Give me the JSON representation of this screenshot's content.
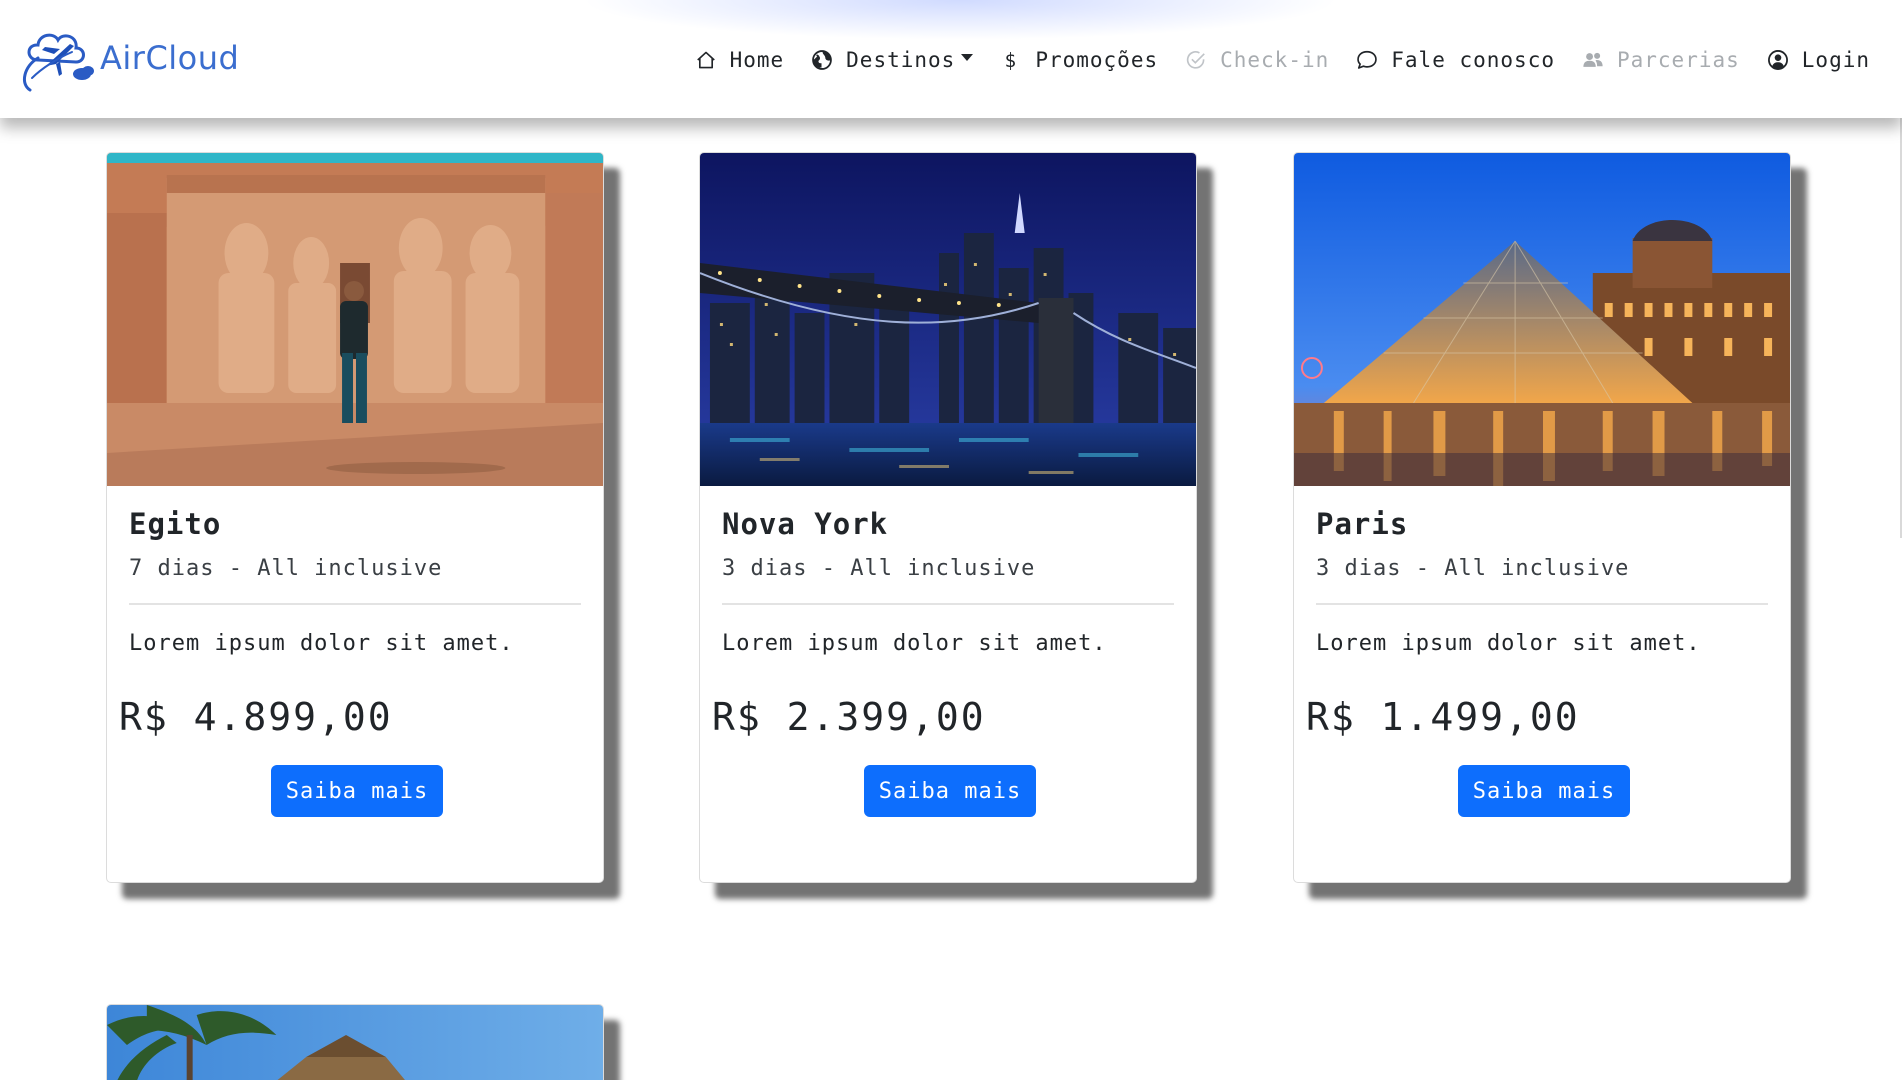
{
  "brand": {
    "name": "AirCloud"
  },
  "nav": {
    "items": [
      {
        "label": "Home",
        "icon": "home-icon"
      },
      {
        "label": "Destinos",
        "icon": "globe-icon",
        "dropdown": true
      },
      {
        "label": "Promoções",
        "icon": "dollar-icon"
      },
      {
        "label": "Check-in",
        "icon": "check-circle-icon",
        "disabled": true
      },
      {
        "label": "Fale conosco",
        "icon": "chat-bubble-icon"
      },
      {
        "label": "Parcerias",
        "icon": "people-icon",
        "disabled": true
      },
      {
        "label": "Login",
        "icon": "user-circle-icon"
      }
    ]
  },
  "cards": [
    {
      "title": "Egito",
      "subtitle": "7 dias - All inclusive",
      "text": "Lorem ipsum dolor sit amet.",
      "price": "R$ 4.899,00",
      "button": "Saiba mais",
      "image": "egypt-temple-image"
    },
    {
      "title": "Nova York",
      "subtitle": "3 dias - All inclusive",
      "text": "Lorem ipsum dolor sit amet.",
      "price": "R$ 2.399,00",
      "button": "Saiba mais",
      "image": "new-york-bridge-image"
    },
    {
      "title": "Paris",
      "subtitle": "3 dias - All inclusive",
      "text": "Lorem ipsum dolor sit amet.",
      "price": "R$ 1.499,00",
      "button": "Saiba mais",
      "image": "paris-louvre-image"
    },
    {
      "image": "tropical-beach-image"
    }
  ],
  "colors": {
    "brand": "#3b6ecf",
    "primary_button": "#0d6efd",
    "disabled_link": "#a8acb0"
  }
}
